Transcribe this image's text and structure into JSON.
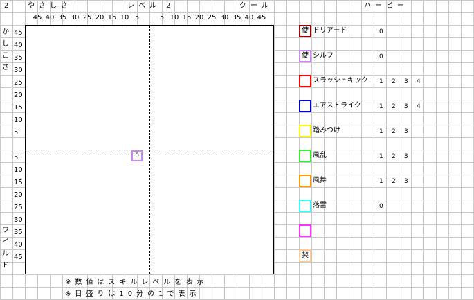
{
  "header": {
    "corner": "2",
    "x_left_title": "やさしさ",
    "x_mid_title": "レベル",
    "x_mid_num": "2",
    "x_right_title": "クール",
    "right_title": "ハービー"
  },
  "axis": {
    "y_top_title": "かしこさ",
    "y_bottom_title": "ワイルド"
  },
  "notes": {
    "line1": "※数値はスキルレベルを表示",
    "line2": "※目盛りは10分の1で表示"
  },
  "chart_data": {
    "type": "scatter",
    "xlabel_left": "やさしさ",
    "xlabel_right": "クール",
    "ylabel_top": "かしこさ",
    "ylabel_bottom": "ワイルド",
    "xlim": [
      -50,
      50
    ],
    "ylim": [
      -50,
      50
    ],
    "x_ticks_left": [
      "45",
      "40",
      "35",
      "30",
      "25",
      "20",
      "15",
      "10",
      "5"
    ],
    "x_ticks_right": [
      "5",
      "10",
      "15",
      "20",
      "25",
      "30",
      "35",
      "40",
      "45"
    ],
    "y_ticks_top": [
      "45",
      "40",
      "35",
      "30",
      "25",
      "20",
      "15",
      "10",
      "5"
    ],
    "y_ticks_bottom": [
      "5",
      "10",
      "15",
      "20",
      "25",
      "30",
      "35",
      "40",
      "45"
    ],
    "points": [
      {
        "series": "シルフ",
        "x": -5,
        "y": -2.5,
        "label": "0",
        "color": "#cc88ee"
      }
    ],
    "grid": true
  },
  "legend": [
    {
      "icon": "使",
      "name": "ドリアード",
      "color": "#990000",
      "values": [
        "0"
      ]
    },
    {
      "icon": "使",
      "name": "シルフ",
      "color": "#cc88ee",
      "values": [
        "0"
      ]
    },
    {
      "icon": "",
      "name": "スラッシュキック",
      "color": "#ff0000",
      "values": [
        "1",
        "2",
        "3",
        "4"
      ]
    },
    {
      "icon": "",
      "name": "エアストライク",
      "color": "#0000cc",
      "values": [
        "1",
        "2",
        "3",
        "4"
      ]
    },
    {
      "icon": "",
      "name": "踏みつけ",
      "color": "#ffff00",
      "values": [
        "1",
        "2",
        "3"
      ]
    },
    {
      "icon": "",
      "name": "風乱",
      "color": "#33ee33",
      "values": [
        "1",
        "2",
        "3"
      ]
    },
    {
      "icon": "",
      "name": "風舞",
      "color": "#ff9900",
      "values": [
        "1",
        "2",
        "3"
      ]
    },
    {
      "icon": "",
      "name": "落雷",
      "color": "#33ffff",
      "values": [
        "0"
      ]
    },
    {
      "icon": "",
      "name": "",
      "color": "#ff33ff",
      "values": []
    },
    {
      "icon": "契",
      "name": "",
      "color": "#ffcc99",
      "values": []
    }
  ]
}
